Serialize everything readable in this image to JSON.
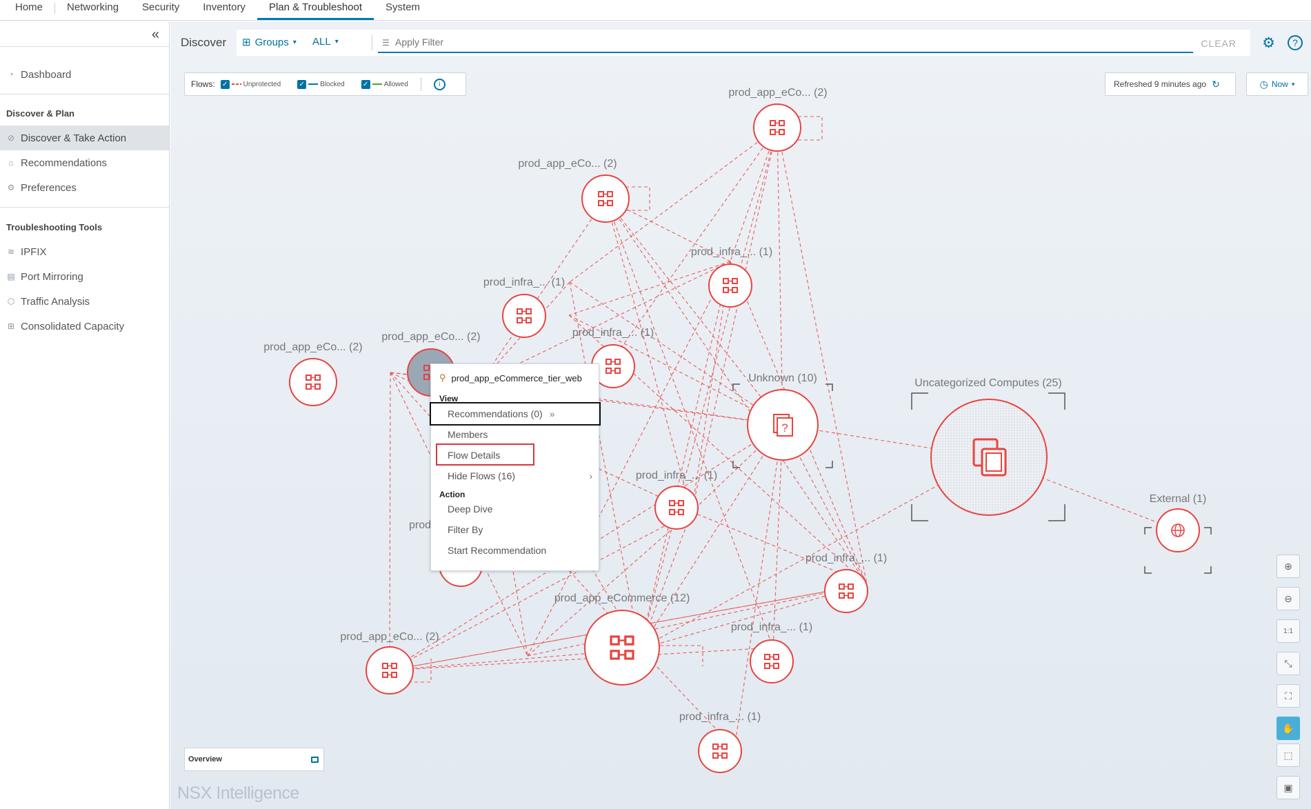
{
  "topnav": {
    "tabs": [
      "Home",
      "Networking",
      "Security",
      "Inventory",
      "Plan & Troubleshoot",
      "System"
    ],
    "active": "Plan & Troubleshoot"
  },
  "sidebar": {
    "collapse_icon": "double-chevron-left-icon",
    "dashboard": "Dashboard",
    "section1": "Discover & Plan",
    "items1": [
      "Discover & Take Action",
      "Recommendations",
      "Preferences"
    ],
    "section2": "Troubleshooting Tools",
    "items2": [
      "IPFIX",
      "Port Mirroring",
      "Traffic Analysis",
      "Consolidated Capacity"
    ]
  },
  "toolbar": {
    "title": "Discover",
    "groups": "Groups",
    "all": "ALL",
    "filter_placeholder": "Apply Filter",
    "clear": "CLEAR"
  },
  "flows": {
    "label": "Flows:",
    "unprotected": "Unprotected",
    "blocked": "Blocked",
    "allowed": "Allowed",
    "colors": {
      "unprotected": "#e9433f",
      "blocked": "#0072a3",
      "allowed": "#5aa220"
    }
  },
  "refreshed": "Refreshed 9 minutes ago",
  "time": "Now",
  "nodes": {
    "n_top": "prod_app_eCo... (2)",
    "n_upper": "prod_app_eCo... (2)",
    "n_infra1": "prod_infra_... (1)",
    "n_infra2": "prod_infra_... (1)",
    "n_selected": "prod_app_eCo... (2)",
    "n_infra3": "prod_infra_... (1)",
    "n_left": "prod_app_eCo... (2)",
    "unknown": "Unknown (10)",
    "uncategorized": "Uncategorized Computes (25)",
    "external": "External (1)",
    "n_infra4": "prod_infra_... (1)",
    "n_infra5": "prod_infra_... (1)",
    "ecommerce": "prod_app_eCommerce (12)",
    "n_bottomleft": "prod_app_eCo... (2)",
    "n_infra6": "prod_infra_... (1)",
    "n_infra7": "prod_infra_... (1)",
    "partial": "prod"
  },
  "context_menu": {
    "title": "prod_app_eCommerce_tier_web",
    "view_header": "View",
    "recommendations": "Recommendations (0)",
    "members": "Members",
    "flow_details": "Flow Details",
    "hide_flows": "Hide Flows (16)",
    "action_header": "Action",
    "deep_dive": "Deep Dive",
    "filter_by": "Filter By",
    "start_recommendation": "Start Recommendation"
  },
  "overview": "Overview",
  "brand": "NSX Intelligence"
}
